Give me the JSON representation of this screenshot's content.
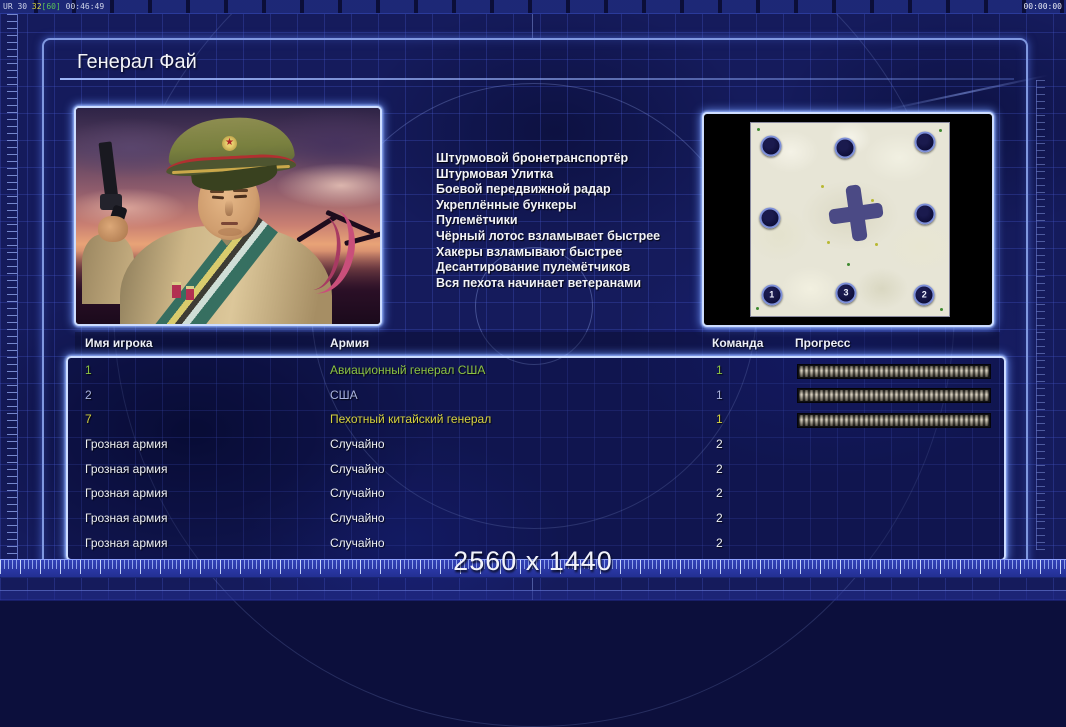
{
  "topbar": {
    "stats": {
      "part1": "UR 30 ",
      "part2": "32",
      "part3": "[60]",
      "part4": " 00:46:49"
    },
    "timer": "00:00:00"
  },
  "header": {
    "title": "Генерал Фай"
  },
  "abilities": [
    "Штурмовой бронетранспортёр",
    "Штурмовая Улитка",
    "Боевой передвижной радар",
    "Укреплённые бункеры",
    "Пулемётчики",
    "Чёрный лотос взламывает быстрее",
    "Хакеры взламывают быстрее",
    "Десантирование пулемётчиков",
    "Вся пехота начинает ветеранами"
  ],
  "minimap": {
    "markers": [
      {
        "x": 10,
        "y": 12,
        "label": ""
      },
      {
        "x": 47.5,
        "y": 13,
        "label": ""
      },
      {
        "x": 88,
        "y": 10,
        "label": ""
      },
      {
        "x": 9.5,
        "y": 49,
        "label": ""
      },
      {
        "x": 88,
        "y": 47,
        "label": ""
      },
      {
        "x": 10.5,
        "y": 89,
        "label": "1"
      },
      {
        "x": 48,
        "y": 88,
        "label": "3"
      },
      {
        "x": 87.5,
        "y": 89,
        "label": "2"
      }
    ]
  },
  "table": {
    "headers": [
      "Имя игрока",
      "Армия",
      "Команда",
      "Прогресс"
    ],
    "rows": [
      {
        "name": "1",
        "army": "Авиационный генерал США",
        "team": "1",
        "progress": 100,
        "color": "#8cc342"
      },
      {
        "name": "2",
        "army": "США",
        "team": "1",
        "progress": 100,
        "color": "#a9b3dd"
      },
      {
        "name": "7",
        "army": "Пехотный китайский генерал",
        "team": "1",
        "progress": 100,
        "color": "#d6d23e"
      },
      {
        "name": "Грозная армия",
        "army": "Случайно",
        "team": "2",
        "progress": null,
        "color": "#eef0f4"
      },
      {
        "name": "Грозная армия",
        "army": "Случайно",
        "team": "2",
        "progress": null,
        "color": "#eef0f4"
      },
      {
        "name": "Грозная армия",
        "army": "Случайно",
        "team": "2",
        "progress": null,
        "color": "#eef0f4"
      },
      {
        "name": "Грозная армия",
        "army": "Случайно",
        "team": "2",
        "progress": null,
        "color": "#eef0f4"
      },
      {
        "name": "Грозная армия",
        "army": "Случайно",
        "team": "2",
        "progress": null,
        "color": "#eef0f4"
      }
    ]
  },
  "footer": {
    "resolution": "2560 x 1440"
  },
  "colors": {
    "panel_glow": "#9db8ff",
    "row_green": "#8cc342",
    "row_blue": "#a9b3dd",
    "row_yellow": "#d6d23e",
    "progress_fill": "#a89f8e"
  }
}
